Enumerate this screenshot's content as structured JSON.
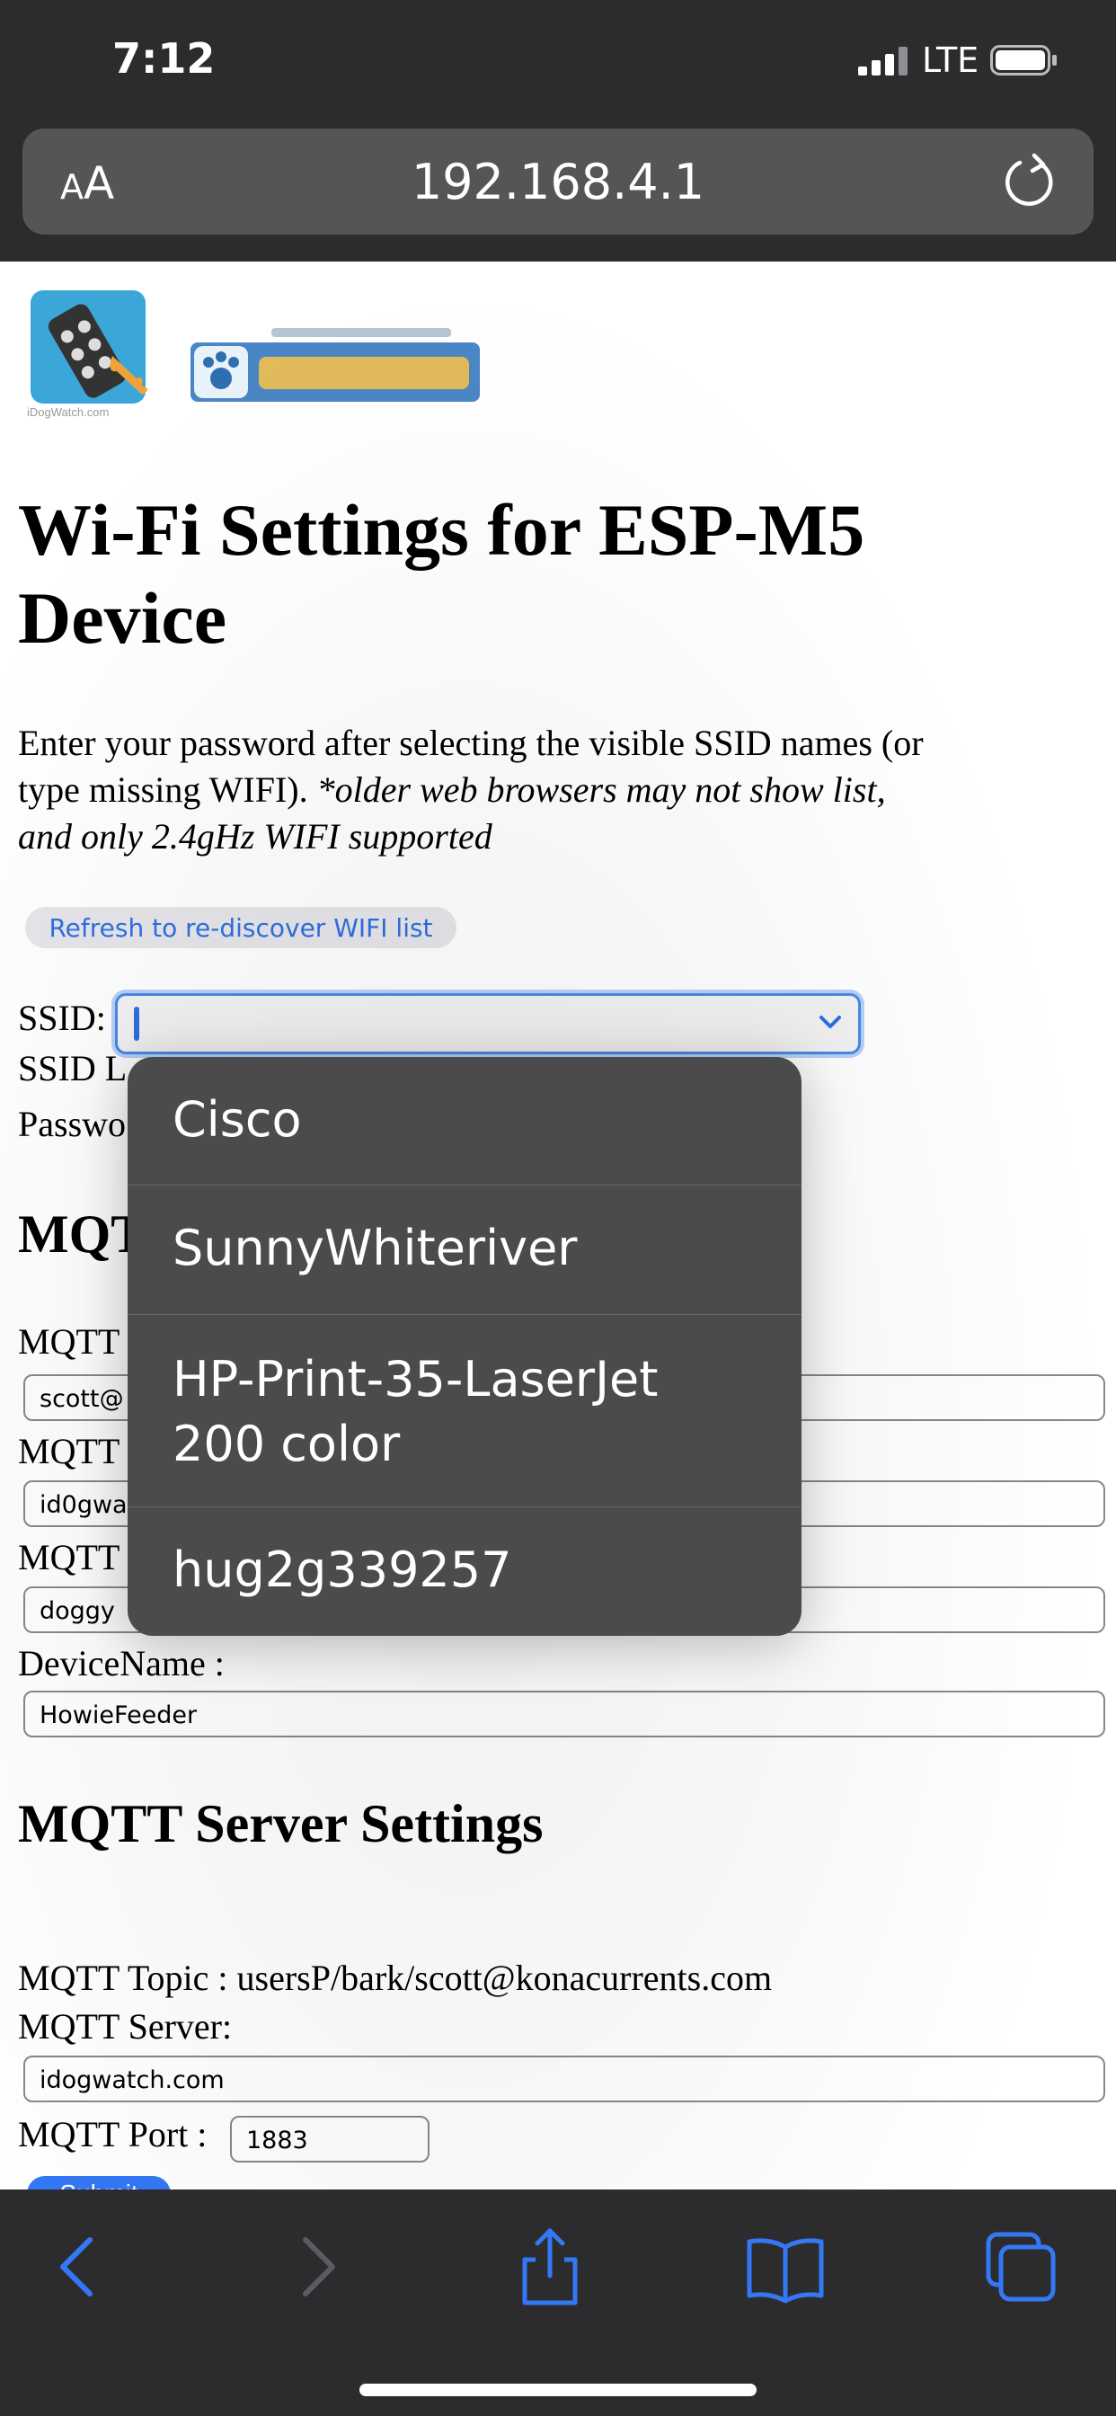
{
  "status_bar": {
    "time": "7:12",
    "carrier": "LTE"
  },
  "address_bar": {
    "aa_small": "A",
    "aa_big": "A",
    "url": "192.168.4.1"
  },
  "page": {
    "logo_caption": "iDogWatch.com",
    "title": "Wi-Fi Settings for ESP-M5 Device",
    "intro_plain": "Enter your password after selecting the visible SSID names (or type missing WIFI). ",
    "intro_italic": "*older web browsers may not show list, and only 2.4gHz WIFI supported",
    "refresh_button": "Refresh to re-discover WIFI list",
    "ssid_label": "SSID:",
    "ssid_list_label_partial": "SSID L",
    "password_label_partial": "Passwo",
    "mqtt_heading_partial": "MQT",
    "mqtt_label_1_partial": "MQTT",
    "mqtt_value_1_partial": "scott@",
    "mqtt_label_2_partial": "MQTT",
    "mqtt_value_2_partial": "id0gwa",
    "mqtt_label_3_partial": "MQTT",
    "mqtt_value_3_partial": "doggy",
    "device_name_label": "DeviceName :",
    "device_name_value": "HowieFeeder",
    "server_heading": "MQTT Server Settings",
    "mqtt_topic_text": "MQTT Topic : usersP/bark/scott@konacurrents.com",
    "mqtt_server_label": "MQTT Server:",
    "mqtt_server_value": "idogwatch.com",
    "mqtt_port_label": "MQTT Port :",
    "mqtt_port_value": "1883",
    "submit_partial": "Submit"
  },
  "dropdown": {
    "options": [
      {
        "label": "Cisco"
      },
      {
        "label": "SunnyWhiteriver"
      },
      {
        "label_line1": "HP-Print-35-LaserJet",
        "label_line2": "200 color"
      },
      {
        "label": "hug2g339257"
      }
    ]
  },
  "toolbar_icons": [
    "back-arrow-icon",
    "forward-arrow-icon",
    "share-icon",
    "bookmarks-icon",
    "tabs-icon"
  ],
  "colors": {
    "accent": "#3478f6",
    "chrome": "#2c2c2e",
    "dropdown": "#4b4b4d"
  }
}
